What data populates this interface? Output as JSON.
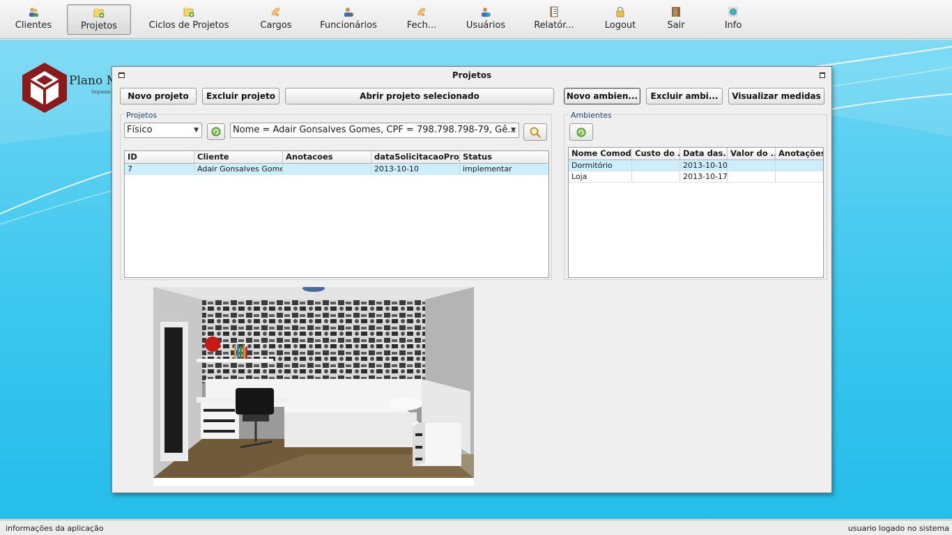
{
  "toolbar": {
    "items": [
      {
        "label": "Clientes",
        "icon": "users-icon"
      },
      {
        "label": "Projetos",
        "icon": "folder-add-icon",
        "active": true
      },
      {
        "label": "Ciclos de Projetos",
        "icon": "folder-add-icon"
      },
      {
        "label": "Cargos",
        "icon": "rss-icon"
      },
      {
        "label": "Funcionários",
        "icon": "user-icon"
      },
      {
        "label": "Fech...",
        "icon": "rss-icon"
      },
      {
        "label": "Usuários",
        "icon": "user-icon"
      },
      {
        "label": "Relatór...",
        "icon": "report-icon"
      },
      {
        "label": "Logout",
        "icon": "lock-icon"
      },
      {
        "label": "Sair",
        "icon": "door-exit-icon"
      },
      {
        "label": "Info",
        "icon": "info-globe-icon"
      }
    ]
  },
  "logo": {
    "title": "Plano M",
    "subtitle": "Organize"
  },
  "window": {
    "title": "Projetos",
    "buttons": {
      "new_project": "Novo projeto",
      "delete_project": "Excluir projeto",
      "open_project": "Abrir projeto selecionado",
      "new_room": "Novo ambien...",
      "delete_room": "Excluir ambi...",
      "view_measures": "Visualizar medidas"
    },
    "projects": {
      "group_label": "Projetos",
      "type_combo": "Físico",
      "filter_combo": "Nome = Adair Gonsalves Gomes, CPF = 798.798.798-79, Gê...",
      "columns": [
        "ID",
        "Cliente",
        "Anotacoes",
        "dataSolicitacaoProj...",
        "Status"
      ],
      "rows": [
        [
          "7",
          "Adair Gonsalves Gomes",
          "",
          "2013-10-10",
          "implementar"
        ]
      ]
    },
    "rooms": {
      "group_label": "Ambientes",
      "columns": [
        "Nome Comodo",
        "Custo do ...",
        "Data das...",
        "Valor do ...",
        "Anotações"
      ],
      "rows": [
        [
          "Dormitório",
          "",
          "2013-10-10",
          "",
          ""
        ],
        [
          "Loja",
          "",
          "2013-10-17",
          "",
          ""
        ]
      ]
    }
  },
  "statusbar": {
    "left": "informações da aplicação",
    "right": "usuario logado no sistema"
  },
  "colors": {
    "desktop": "#3cc7ee",
    "selected_row": "#cdeefc",
    "logo_red": "#8b1a1a"
  }
}
